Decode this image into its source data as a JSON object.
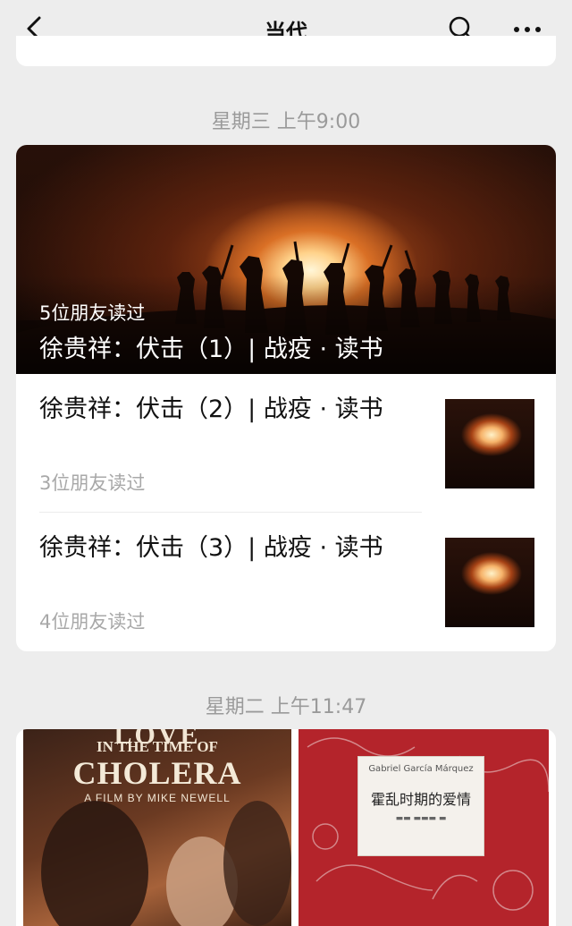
{
  "navbar": {
    "title": "当代",
    "back_icon": "chevron-left-icon",
    "search_icon": "search-icon",
    "more_icon": "more-icon"
  },
  "groups": [
    {
      "time": "星期三 上午9:00",
      "cover": {
        "friends": "5位朋友读过",
        "title": "徐贵祥：伏击（1）| 战疫 · 读书"
      },
      "articles": [
        {
          "title": "徐贵祥：伏击（2）| 战疫 · 读书",
          "friends": "3位朋友读过"
        },
        {
          "title": "徐贵祥：伏击（3）| 战疫 · 读书",
          "friends": "4位朋友读过"
        }
      ]
    },
    {
      "time": "星期二 上午11:47",
      "poster_left": {
        "love": "LOVE",
        "time_of": "IN THE TIME OF",
        "cholera": "CHOLERA",
        "credit": "A FILM BY MIKE NEWELL"
      },
      "poster_right": {
        "author": "Gabriel García Márquez",
        "title": "霍乱时期的爱情"
      }
    }
  ]
}
